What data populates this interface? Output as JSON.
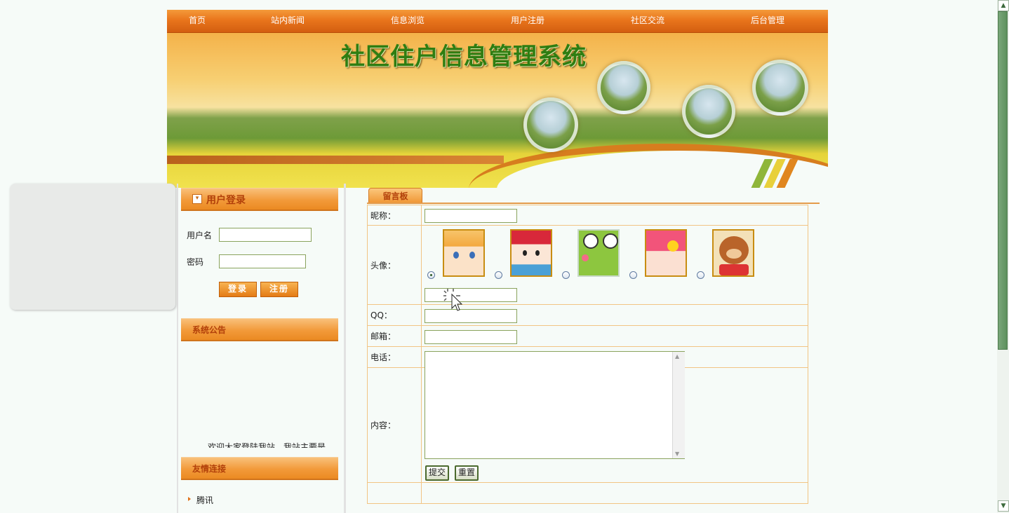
{
  "nav": {
    "items": [
      {
        "label": "首页"
      },
      {
        "label": "站内新闻"
      },
      {
        "label": "信息浏览"
      },
      {
        "label": "用户注册"
      },
      {
        "label": "社区交流"
      },
      {
        "label": "后台管理"
      }
    ]
  },
  "banner": {
    "title": "社区住户信息管理系统"
  },
  "login": {
    "heading": "用户登录",
    "username_label": "用户名",
    "password_label": "密码",
    "username_value": "",
    "password_value": "",
    "login_button": "登录",
    "register_button": "注册"
  },
  "notice": {
    "heading": "系统公告",
    "marquee_text": "欢迎大家登陆我站，我站主要是"
  },
  "links": {
    "heading": "友情连接",
    "items": [
      {
        "label": "腾讯"
      }
    ]
  },
  "guestbook": {
    "tab_label": "留言板",
    "nickname_label": "昵称：",
    "nickname_value": "",
    "avatar_label": "头像：",
    "avatars": [
      {
        "name": "avatar-orange-hair-girl",
        "selected": true
      },
      {
        "name": "avatar-red-hood-girl",
        "selected": false
      },
      {
        "name": "avatar-green-frog",
        "selected": false
      },
      {
        "name": "avatar-pink-helmet-girl",
        "selected": false
      },
      {
        "name": "avatar-brown-bear",
        "selected": false
      }
    ],
    "qq_label": "QQ：",
    "qq_value": "",
    "email_label": "邮箱：",
    "email_value": "",
    "phone_label": "电话：",
    "phone_value": "",
    "content_label": "内容：",
    "content_value": "",
    "submit_button": "提交",
    "reset_button": "重置"
  },
  "colors": {
    "nav_orange": "#e9751c",
    "panel_title": "#b2400a",
    "title_green": "#2f7d12",
    "form_border": "#f1c484",
    "page_bg": "#f6fbf8"
  }
}
